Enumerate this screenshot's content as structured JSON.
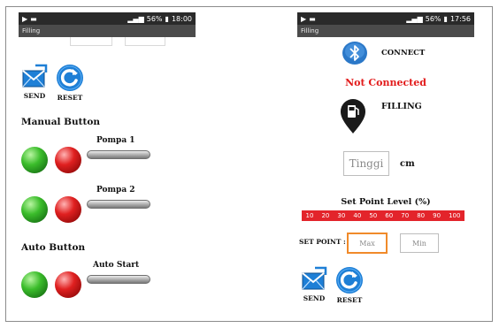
{
  "status_left": {
    "time": "18:00",
    "battery": "56%"
  },
  "status_right": {
    "time": "17:56",
    "battery": "56%"
  },
  "app_title": "Filling",
  "left": {
    "send_label": "SEND",
    "reset_label": "RESET",
    "manual_title": "Manual Button",
    "pump1_label": "Pompa 1",
    "pump2_label": "Pompa 2",
    "auto_title": "Auto Button",
    "auto_start_label": "Auto Start"
  },
  "right": {
    "connect_label": "CONNECT",
    "connection_status": "Not Connected",
    "filling_label": "FILLING",
    "height_placeholder": "Tinggi",
    "height_unit": "cm",
    "setpoint_title": "Set Point Level (%)",
    "levels": [
      "10",
      "20",
      "30",
      "40",
      "50",
      "60",
      "70",
      "80",
      "90",
      "100"
    ],
    "setpoint_label": "SET POINT :",
    "max_placeholder": "Max",
    "min_placeholder": "Min",
    "send_label": "SEND",
    "reset_label": "RESET"
  },
  "colors": {
    "accent_red": "#e3242b",
    "status_red": "#e21a1a",
    "icon_blue": "#1e7fd6",
    "focus_orange": "#f08a2a"
  }
}
